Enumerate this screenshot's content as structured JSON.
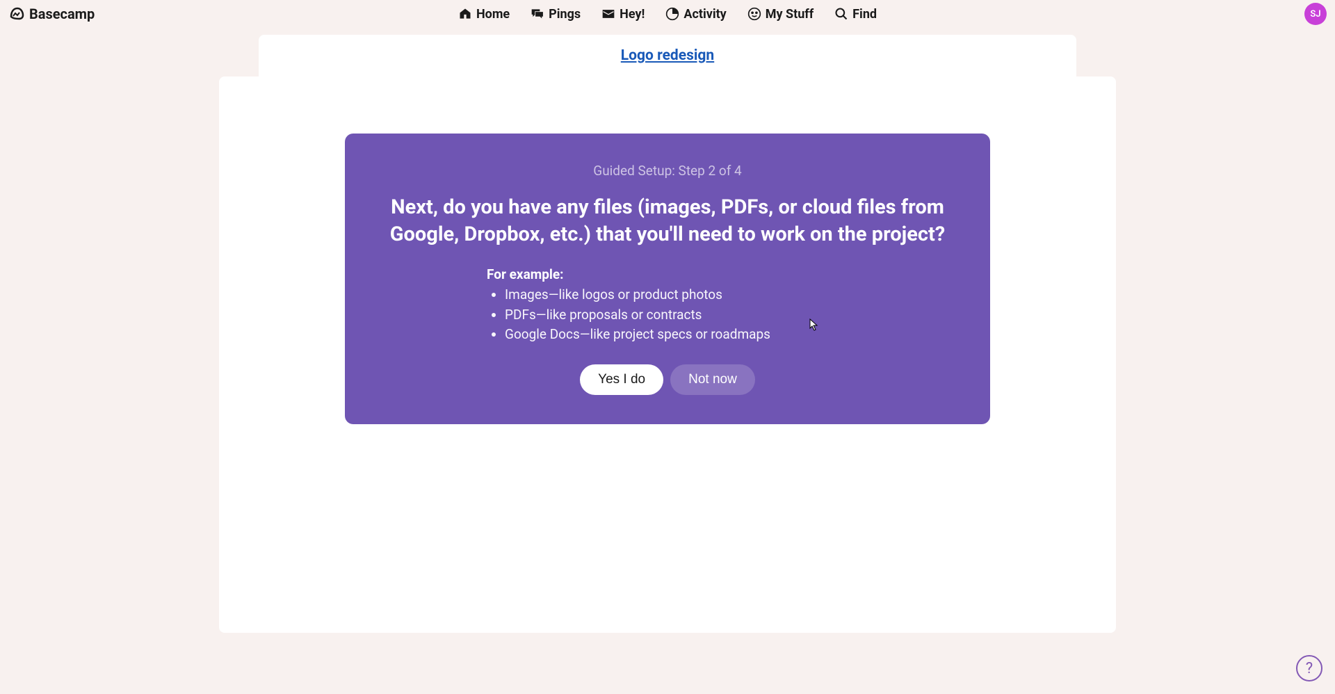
{
  "logo": {
    "text": "Basecamp"
  },
  "nav": {
    "home": "Home",
    "pings": "Pings",
    "hey": "Hey!",
    "activity": "Activity",
    "mystuff": "My Stuff",
    "find": "Find"
  },
  "avatar": {
    "initials": "SJ"
  },
  "breadcrumb": {
    "project": "Logo redesign"
  },
  "setup": {
    "step_indicator": "Guided Setup: Step 2 of 4",
    "heading": "Next, do you have any files (images, PDFs, or cloud files from Google, Dropbox, etc.) that you'll need to work on the project?",
    "examples_label": "For example:",
    "examples": [
      "Images—like logos or product photos",
      "PDFs—like proposals or contracts",
      "Google Docs—like project specs or roadmaps"
    ],
    "yes_button": "Yes I do",
    "no_button": "Not now"
  },
  "help": {
    "label": "?"
  }
}
